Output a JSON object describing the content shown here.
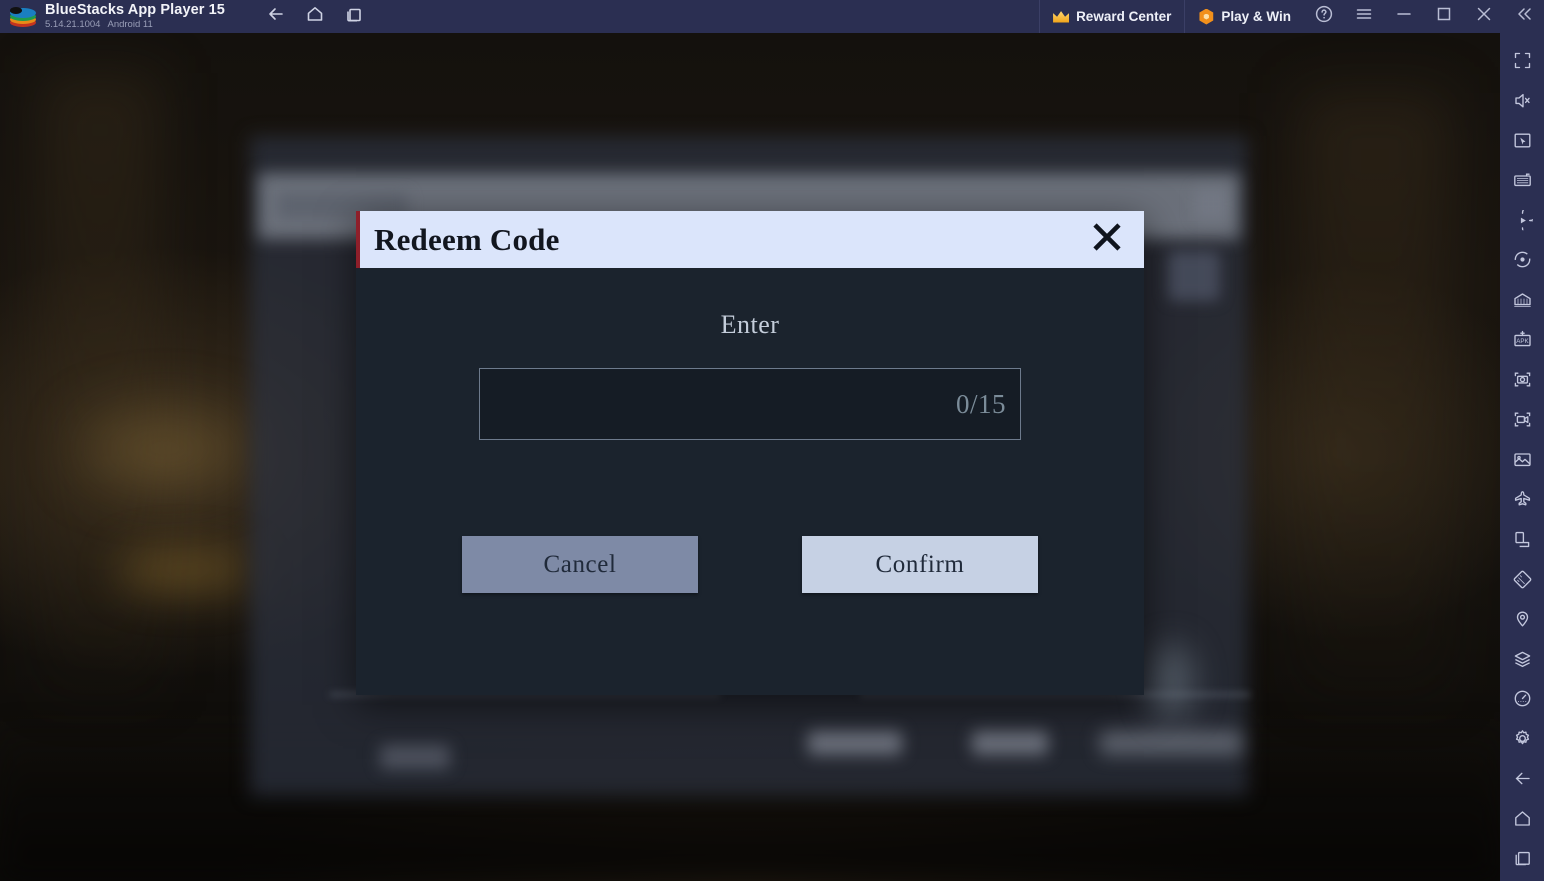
{
  "titlebar": {
    "app_name": "BlueStacks App Player 15",
    "version": "5.14.21.1004",
    "android_version": "Android 11",
    "logo_icon": "bluestacks-logo-icon",
    "nav": [
      {
        "name": "back",
        "icon": "arrow-left-icon"
      },
      {
        "name": "home",
        "icon": "home-icon"
      },
      {
        "name": "recents",
        "icon": "multi-window-icon"
      }
    ],
    "reward_center": {
      "label": "Reward Center",
      "icon": "crown-icon"
    },
    "play_and_win": {
      "label": "Play & Win",
      "icon": "hex-coin-icon"
    },
    "window_buttons": [
      {
        "name": "help",
        "icon": "question-circle-icon"
      },
      {
        "name": "menu",
        "icon": "hamburger-menu-icon"
      },
      {
        "name": "minimize",
        "icon": "minimize-icon"
      },
      {
        "name": "maximize",
        "icon": "maximize-icon"
      },
      {
        "name": "close",
        "icon": "close-icon"
      },
      {
        "name": "collapse-sidebar",
        "icon": "chevron-double-left-icon"
      }
    ]
  },
  "sidebar": {
    "background": "#2b2f52",
    "items": [
      {
        "name": "fullscreen",
        "icon": "fullscreen-icon"
      },
      {
        "name": "mute",
        "icon": "speaker-mute-icon"
      },
      {
        "name": "controls",
        "icon": "cursor-box-icon"
      },
      {
        "name": "macro",
        "icon": "keymap-box-icon"
      },
      {
        "name": "script",
        "icon": "play-circle-icon"
      },
      {
        "name": "record",
        "icon": "record-circle-icon"
      },
      {
        "name": "multi-instance",
        "icon": "instance-manager-icon"
      },
      {
        "name": "install-apk",
        "icon": "apk-install-icon"
      },
      {
        "name": "screenshot",
        "icon": "camera-icon"
      },
      {
        "name": "screen-record",
        "icon": "video-camera-icon"
      },
      {
        "name": "media-manager",
        "icon": "image-gallery-icon"
      },
      {
        "name": "shake",
        "icon": "airplane-icon"
      },
      {
        "name": "rotate",
        "icon": "rotate-screen-icon"
      },
      {
        "name": "tilt",
        "icon": "tilt-icon"
      },
      {
        "name": "location",
        "icon": "location-pin-icon"
      },
      {
        "name": "layers",
        "icon": "layers-icon"
      },
      {
        "name": "performance",
        "icon": "speedometer-icon"
      },
      {
        "name": "settings",
        "icon": "gear-icon"
      },
      {
        "name": "back",
        "icon": "arrow-left-icon"
      },
      {
        "name": "home",
        "icon": "home-icon"
      },
      {
        "name": "recents",
        "icon": "multi-window-icon"
      }
    ]
  },
  "modal": {
    "title": "Redeem Code",
    "close_icon": "close-x-icon",
    "accent_color": "#8e1f2a",
    "header_bg": "#dbe5fb",
    "body_bg": "#1b232d",
    "field_label": "Enter",
    "input": {
      "value": "",
      "placeholder": "",
      "counter": "0/15",
      "max_length": 15
    },
    "buttons": {
      "cancel": {
        "label": "Cancel",
        "color": "#7e8aa6"
      },
      "confirm": {
        "label": "Confirm",
        "color": "#c6d1e4"
      }
    }
  }
}
